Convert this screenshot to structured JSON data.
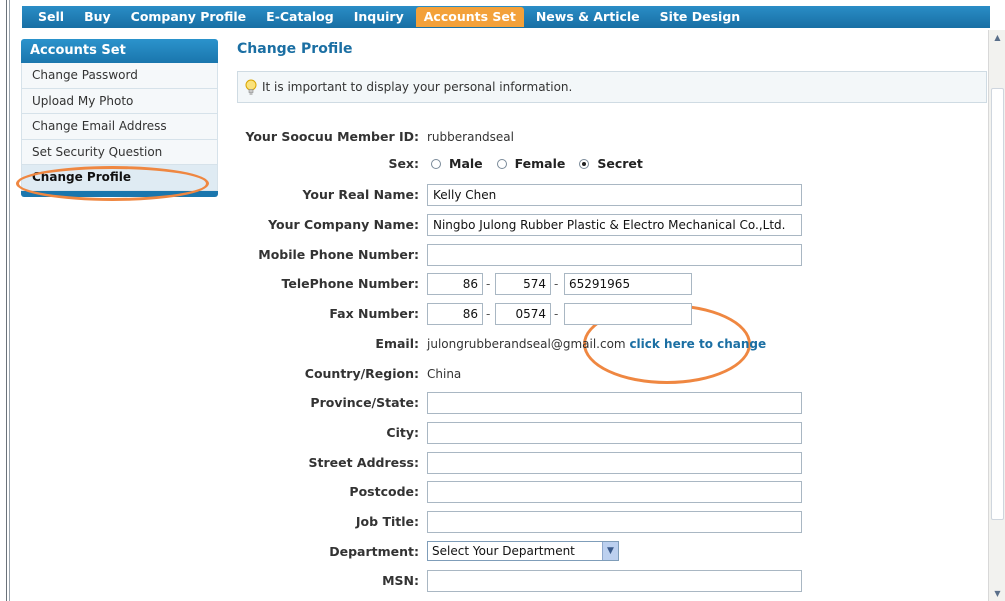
{
  "topnav": {
    "items": [
      {
        "label": "Sell"
      },
      {
        "label": "Buy"
      },
      {
        "label": "Company Profile"
      },
      {
        "label": "E-Catalog"
      },
      {
        "label": "Inquiry"
      },
      {
        "label": "Accounts Set"
      },
      {
        "label": "News & Article"
      },
      {
        "label": "Site Design"
      }
    ],
    "active": "Accounts Set"
  },
  "sidebar": {
    "title": "Accounts Set",
    "items": [
      {
        "label": "Change Password"
      },
      {
        "label": "Upload My Photo"
      },
      {
        "label": "Change Email Address"
      },
      {
        "label": "Set Security Question"
      },
      {
        "label": "Change Profile"
      }
    ],
    "active": "Change Profile"
  },
  "main": {
    "title": "Change Profile",
    "notice": "It is important to display your personal information."
  },
  "form": {
    "member_id": {
      "label": "Your Soocuu Member ID:",
      "value": "rubberandseal"
    },
    "sex": {
      "label": "Sex:",
      "options": [
        "Male",
        "Female",
        "Secret"
      ],
      "selected": "Secret"
    },
    "real_name": {
      "label": "Your Real Name:",
      "value": "Kelly Chen"
    },
    "company_name": {
      "label": "Your Company Name:",
      "value": "Ningbo Julong Rubber Plastic & Electro Mechanical Co.,Ltd."
    },
    "mobile": {
      "label": "Mobile Phone Number:",
      "value": ""
    },
    "telephone": {
      "label": "TelePhone Number:",
      "country": "86",
      "area": "574",
      "number": "65291965",
      "sep": "-"
    },
    "fax": {
      "label": "Fax Number:",
      "country": "86",
      "area": "0574",
      "number": "",
      "sep": "-"
    },
    "email": {
      "label": "Email:",
      "value": "julongrubberandseal@gmail.com",
      "change_link": "click here to change"
    },
    "country": {
      "label": "Country/Region:",
      "value": "China"
    },
    "province": {
      "label": "Province/State:",
      "value": ""
    },
    "city": {
      "label": "City:",
      "value": ""
    },
    "street": {
      "label": "Street Address:",
      "value": ""
    },
    "postcode": {
      "label": "Postcode:",
      "value": ""
    },
    "job_title": {
      "label": "Job Title:",
      "value": ""
    },
    "department": {
      "label": "Department:",
      "value": "Select Your Department"
    },
    "msn": {
      "label": "MSN:",
      "value": ""
    }
  },
  "colors": {
    "nav_blue": "#1d7db4",
    "accent_orange": "#f3a13a",
    "annotation_orange": "#ef8741",
    "link_blue": "#1b6fa3"
  }
}
